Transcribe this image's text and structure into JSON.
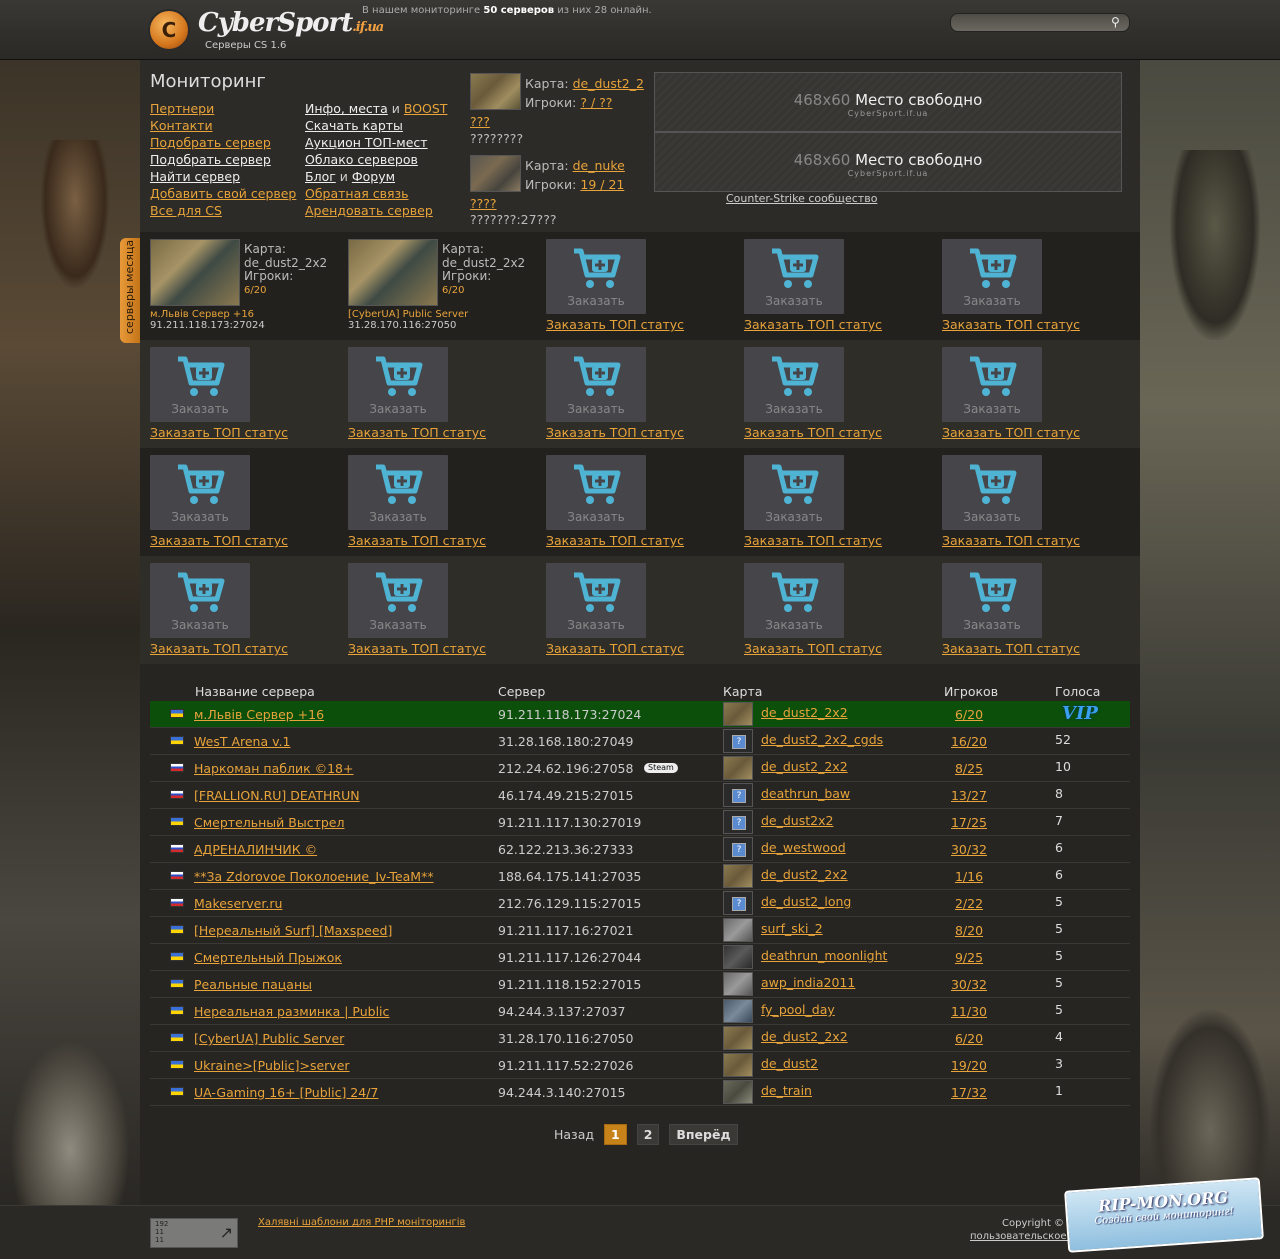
{
  "header": {
    "logo_letter": "C",
    "logo_main": "CyberSport",
    "logo_tld": ".if.ua",
    "logo_sub": "Серверы CS 1.6",
    "info_prefix": "В нашем мониторинге",
    "info_count": "50 серверов",
    "info_suffix": "из них 28 онлайн.",
    "search_placeholder": "",
    "search_icon": "search-icon"
  },
  "monitor": {
    "title": "Мониторинг",
    "menu_left": [
      {
        "label": "Пертнери",
        "style": "orange"
      },
      {
        "label": "Контакти",
        "style": "orange"
      },
      {
        "label": "Подобрать сервер",
        "style": "orange"
      },
      {
        "label": "Подобрать сервер",
        "style": "white"
      },
      {
        "label": "Найти сервер",
        "style": "white"
      },
      {
        "label": "Добавить свой сервер",
        "style": "orange"
      },
      {
        "label": "Все для CS",
        "style": "orange"
      }
    ],
    "menu_right": {
      "r1a": "Инфо, места",
      "r1and": "и",
      "r1b": "BOOST",
      "r2": "Скачать карты",
      "r3": "Аукцион ТОП-мест",
      "r4": "Облако серверов",
      "r5a": "Блог",
      "r5and": "и",
      "r5b": "Форум",
      "r6": "Обратная связь",
      "r7": "Арендовать сервер"
    },
    "watermark": "Мониторинг"
  },
  "featured": [
    {
      "map_label": "Карта:",
      "map": "de_dust2_2",
      "players_label": "Игроки:",
      "players": "? / ??",
      "name": "???",
      "extra": "????????"
    },
    {
      "map_label": "Карта:",
      "map": "de_nuke",
      "players_label": "Игроки:",
      "players": "19 / 21",
      "name": "????",
      "extra": "???????:27???"
    }
  ],
  "ads": [
    {
      "size": "468x60",
      "text": "Место свободно",
      "site": "CyberSport.if.ua"
    },
    {
      "size": "468x60",
      "text": "Место свободно",
      "site": "CyberSport.if.ua"
    }
  ],
  "cs_community": "Counter-Strike сообщество",
  "month_tab": "серверы месяца",
  "top_servers": [
    {
      "map_label": "Карта:",
      "map": "de_dust2_2x2",
      "players_label": "Игроки:",
      "players": "6/20",
      "name": "м.Львів Сервер +16",
      "addr": "91.211.118.173:27024"
    },
    {
      "map_label": "Карта:",
      "map": "de_dust2_2x2",
      "players_label": "Игроки:",
      "players": "6/20",
      "name": "[CyberUA] Public Server",
      "addr": "31.28.170.116:27050"
    }
  ],
  "order": {
    "box_text": "Заказать",
    "link": "Заказать ТОП статус",
    "icon": "cart-icon"
  },
  "table": {
    "headers": {
      "name": "Название сервера",
      "server": "Сервер",
      "map": "Карта",
      "players": "Игроков",
      "votes": "Голоса"
    },
    "vip_label": "VIP",
    "steam_label": "Steam",
    "rows": [
      {
        "flag": "ua",
        "name": "м.Львів Сервер +16",
        "addr": "91.211.118.173:27024",
        "mapicon": "dust",
        "map": "de_dust2_2x2",
        "players": "6/20",
        "votes": "",
        "vip": true
      },
      {
        "flag": "ua",
        "name": "WesT Arena v.1",
        "addr": "31.28.168.180:27049",
        "mapicon": "q",
        "map": "de_dust2_2x2_cgds",
        "players": "16/20",
        "votes": "52"
      },
      {
        "flag": "ru",
        "name": "Наркоман паблик ©18+",
        "addr": "212.24.62.196:27058",
        "steam": true,
        "mapicon": "dust",
        "map": "de_dust2_2x2",
        "players": "8/25",
        "votes": "10"
      },
      {
        "flag": "ru",
        "name": "[FRALLION.RU] DEATHRUN",
        "addr": "46.174.49.215:27015",
        "mapicon": "q",
        "map": "deathrun_baw",
        "players": "13/27",
        "votes": "8"
      },
      {
        "flag": "ua",
        "name": "Смертельный Выстрел",
        "addr": "91.211.117.130:27019",
        "mapicon": "q",
        "map": "de_dust2x2",
        "players": "17/25",
        "votes": "7"
      },
      {
        "flag": "ru",
        "name": "АДРЕНАЛИНЧИК ©",
        "addr": "62.122.213.36:27333",
        "mapicon": "q",
        "map": "de_westwood",
        "players": "30/32",
        "votes": "6"
      },
      {
        "flag": "ru",
        "name": "**За Zdorovoe Поколоение_Iv-TeaM**",
        "addr": "188.64.175.141:27035",
        "mapicon": "dust",
        "map": "de_dust2_2x2",
        "players": "1/16",
        "votes": "6"
      },
      {
        "flag": "ru",
        "name": "Makeserver.ru",
        "addr": "212.76.129.115:27015",
        "mapicon": "q",
        "map": "de_dust2_long",
        "players": "2/22",
        "votes": "5"
      },
      {
        "flag": "ua",
        "name": "[Нереальный Surf] [Maxspeed]",
        "addr": "91.211.117.16:27021",
        "mapicon": "gray",
        "map": "surf_ski_2",
        "players": "8/20",
        "votes": "5"
      },
      {
        "flag": "ua",
        "name": "Смертельный Прыжок",
        "addr": "91.211.117.126:27044",
        "mapicon": "dark",
        "map": "deathrun_moonlight",
        "players": "9/25",
        "votes": "5"
      },
      {
        "flag": "ua",
        "name": "Реальные пацаны",
        "addr": "91.211.118.152:27015",
        "mapicon": "gray",
        "map": "awp_india2011",
        "players": "30/32",
        "votes": "5"
      },
      {
        "flag": "ua",
        "name": "Нереальная разминка | Public",
        "addr": "94.244.3.137:27037",
        "mapicon": "pool",
        "map": "fy_pool_day",
        "players": "11/30",
        "votes": "5"
      },
      {
        "flag": "ua",
        "name": "[CyberUA] Public Server",
        "addr": "31.28.170.116:27050",
        "mapicon": "dust",
        "map": "de_dust2_2x2",
        "players": "6/20",
        "votes": "4"
      },
      {
        "flag": "ua",
        "name": "Ukraine>[Public]>server",
        "addr": "91.211.117.52:27026",
        "mapicon": "dust",
        "map": "de_dust2",
        "players": "19/20",
        "votes": "3"
      },
      {
        "flag": "ua",
        "name": "UA-Gaming 16+ [Public] 24/7",
        "addr": "94.244.3.140:27015",
        "mapicon": "train",
        "map": "de_train",
        "players": "17/32",
        "votes": "1"
      }
    ]
  },
  "pager": {
    "prev": "Назад",
    "pages": [
      "1",
      "2"
    ],
    "current": "1",
    "next": "Вперёд"
  },
  "footer": {
    "counter_nums": "192\n11\n11",
    "counter_arrow": "↗",
    "templates_link": "Халявні шаблони для PHP моніторингів",
    "copyright": "Copyright ©",
    "user_agreement": "пользовательское соглашение",
    "ripmon_title": "RIP-MON.ORG",
    "ripmon_sub": "Создай свой мониторинг!"
  }
}
